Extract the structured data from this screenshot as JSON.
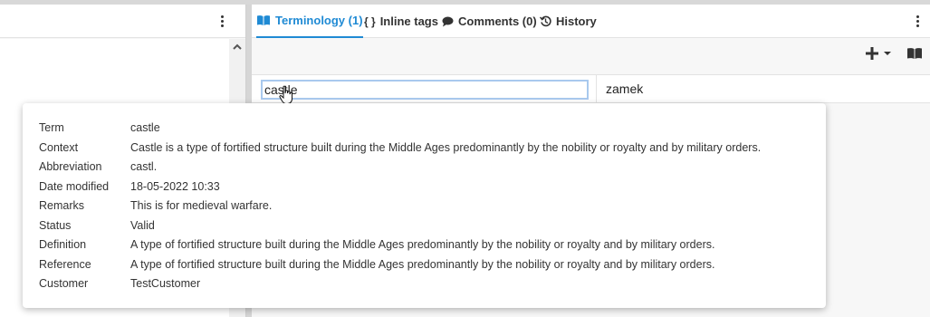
{
  "tabs": [
    {
      "label": "Terminology (1)",
      "icon": "book-open-icon",
      "active": true
    },
    {
      "label": "Inline tags",
      "icon": "braces-icon",
      "active": false
    },
    {
      "label": "Comments (0)",
      "icon": "comment-icon",
      "active": false
    },
    {
      "label": "History",
      "icon": "history-icon",
      "active": false
    }
  ],
  "term": {
    "source": "castle",
    "target": "zamek"
  },
  "details": [
    {
      "key": "Term",
      "value": "castle"
    },
    {
      "key": "Context",
      "value": "Castle is a type of fortified structure built during the Middle Ages predominantly by the nobility or royalty and by military orders."
    },
    {
      "key": "Abbreviation",
      "value": "castl."
    },
    {
      "key": "Date modified",
      "value": "18-05-2022 10:33"
    },
    {
      "key": "Remarks",
      "value": "This is for medieval warfare."
    },
    {
      "key": "Status",
      "value": "Valid"
    },
    {
      "key": "Definition",
      "value": "A type of fortified structure built during the Middle Ages predominantly by the nobility or royalty and by military orders."
    },
    {
      "key": "Reference",
      "value": "A type of fortified structure built during the Middle Ages predominantly by the nobility or royalty and by military orders."
    },
    {
      "key": "Customer",
      "value": "TestCustomer"
    }
  ],
  "colors": {
    "accent": "#1f8ad4",
    "focus_border": "#a9c9ee"
  }
}
